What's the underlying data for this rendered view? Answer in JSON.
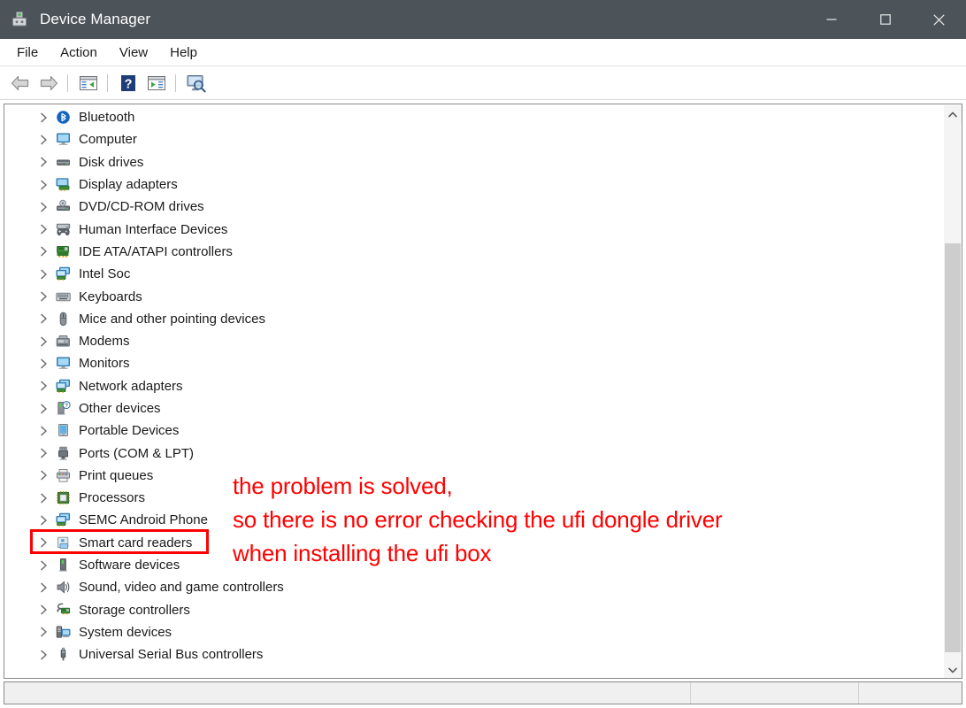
{
  "window": {
    "title": "Device Manager",
    "icon": "device-manager-icon",
    "controls": [
      {
        "name": "minimize-button",
        "glyph": "minimize"
      },
      {
        "name": "maximize-button",
        "glyph": "maximize"
      },
      {
        "name": "close-button",
        "glyph": "close"
      }
    ]
  },
  "menubar": {
    "items": [
      {
        "label": "File"
      },
      {
        "label": "Action"
      },
      {
        "label": "View"
      },
      {
        "label": "Help"
      }
    ]
  },
  "toolbar": {
    "buttons": [
      {
        "name": "back-button",
        "icon": "back-arrow-icon"
      },
      {
        "name": "forward-button",
        "icon": "forward-arrow-icon"
      },
      {
        "name": "separator-1",
        "icon": "separator"
      },
      {
        "name": "show-console-tree-button",
        "icon": "console-tree-icon"
      },
      {
        "name": "separator-2",
        "icon": "separator"
      },
      {
        "name": "help-button",
        "icon": "help-question-icon"
      },
      {
        "name": "properties-button",
        "icon": "properties-panel-icon"
      },
      {
        "name": "separator-3",
        "icon": "separator"
      },
      {
        "name": "scan-hardware-changes-button",
        "icon": "scan-monitor-icon"
      }
    ]
  },
  "tree": {
    "items": [
      {
        "label": "Bluetooth",
        "icon": "bluetooth-icon"
      },
      {
        "label": "Computer",
        "icon": "computer-monitor-icon"
      },
      {
        "label": "Disk drives",
        "icon": "disk-drive-icon"
      },
      {
        "label": "Display adapters",
        "icon": "display-adapter-icon"
      },
      {
        "label": "DVD/CD-ROM drives",
        "icon": "dvd-drive-icon"
      },
      {
        "label": "Human Interface Devices",
        "icon": "hid-gamepad-icon"
      },
      {
        "label": "IDE ATA/ATAPI controllers",
        "icon": "ide-controller-icon"
      },
      {
        "label": "Intel Soc",
        "icon": "network-card-icon"
      },
      {
        "label": "Keyboards",
        "icon": "keyboard-icon"
      },
      {
        "label": "Mice and other pointing devices",
        "icon": "mouse-icon"
      },
      {
        "label": "Modems",
        "icon": "modem-icon"
      },
      {
        "label": "Monitors",
        "icon": "monitor-icon"
      },
      {
        "label": "Network adapters",
        "icon": "network-adapter-icon"
      },
      {
        "label": "Other devices",
        "icon": "other-devices-question-icon"
      },
      {
        "label": "Portable Devices",
        "icon": "portable-device-icon"
      },
      {
        "label": "Ports (COM & LPT)",
        "icon": "port-connector-icon"
      },
      {
        "label": "Print queues",
        "icon": "printer-icon"
      },
      {
        "label": "Processors",
        "icon": "processor-chip-icon"
      },
      {
        "label": "SEMC Android Phone",
        "icon": "android-phone-adapter-icon"
      },
      {
        "label": "Smart card readers",
        "icon": "smart-card-reader-icon",
        "highlighted": true
      },
      {
        "label": "Software devices",
        "icon": "software-device-icon"
      },
      {
        "label": "Sound, video and game controllers",
        "icon": "speaker-icon"
      },
      {
        "label": "Storage controllers",
        "icon": "storage-controller-icon"
      },
      {
        "label": "System devices",
        "icon": "system-device-icon"
      },
      {
        "label": "Universal Serial Bus controllers",
        "icon": "usb-icon"
      }
    ],
    "expander_glyph": "chevron-right"
  },
  "scrollbar": {
    "up_glyph": "chevron-up",
    "down_glyph": "chevron-down"
  },
  "statusbar": {
    "segments": [
      "",
      "",
      ""
    ]
  },
  "annotations": {
    "highlight_target": "Smart card readers",
    "note_lines": [
      "the problem is solved,",
      "so there is no error checking the ufi dongle driver",
      "when installing the ufi box"
    ],
    "color": "#ff0000"
  }
}
